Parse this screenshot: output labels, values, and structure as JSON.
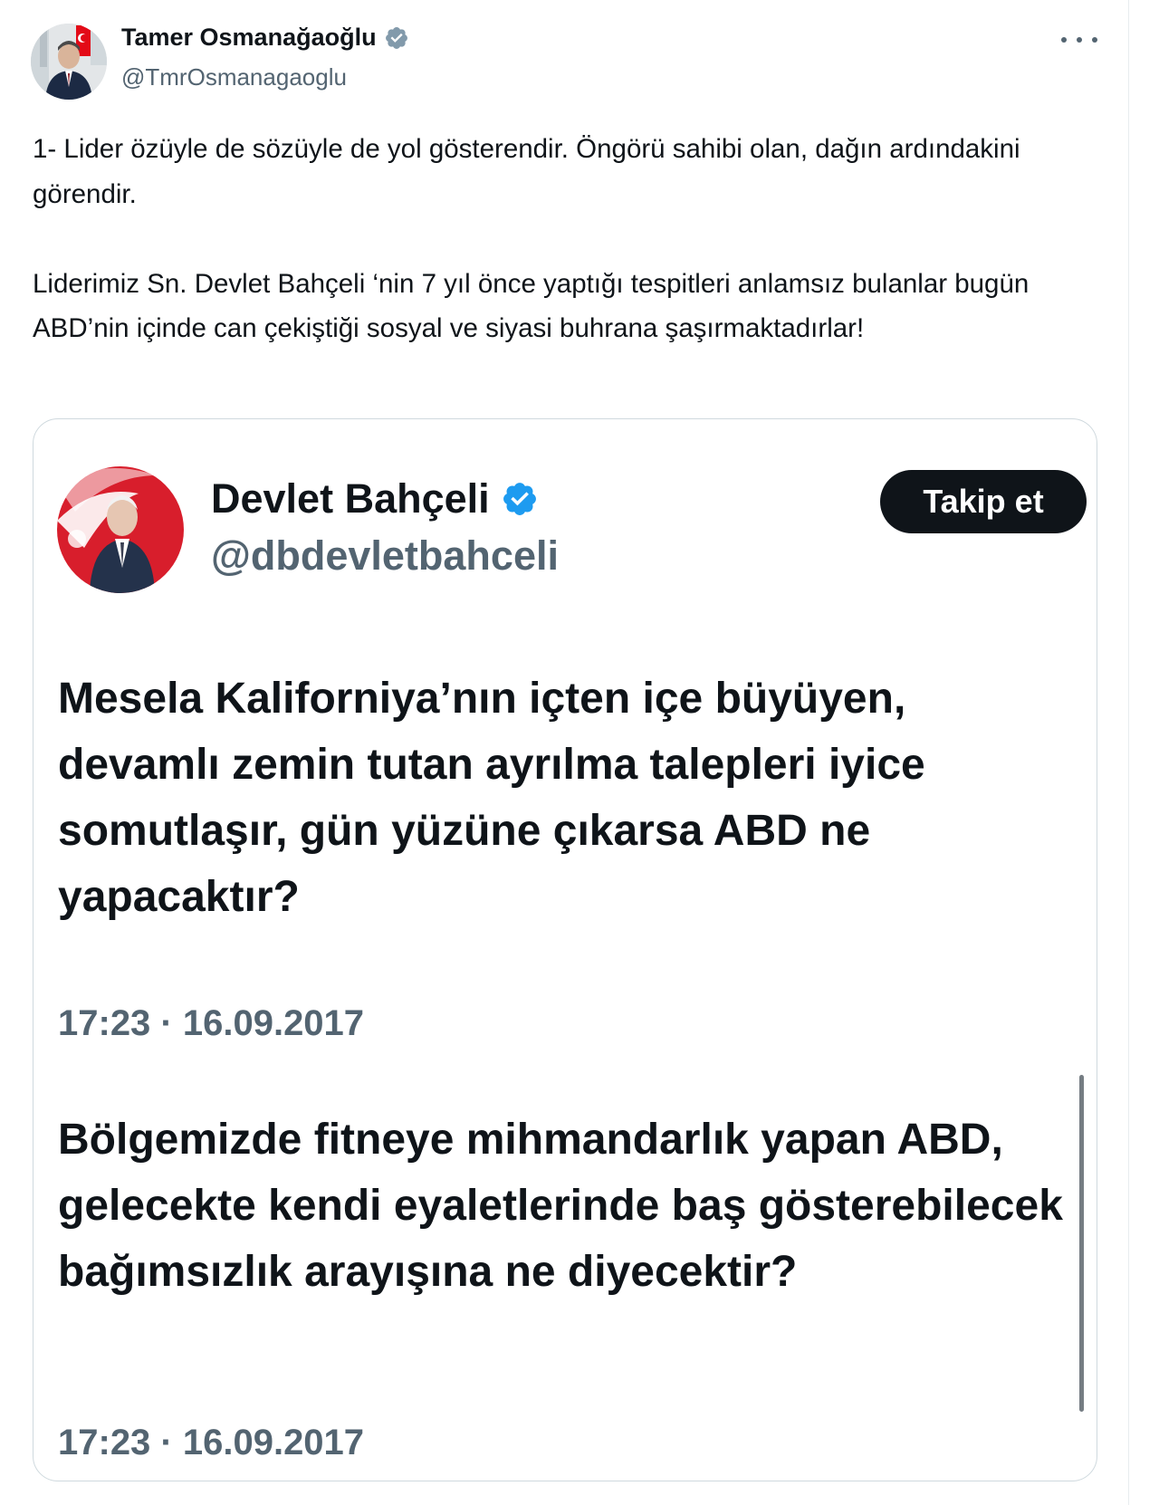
{
  "author": {
    "name": "Tamer Osmanağaoğlu",
    "handle": "@TmrOsmanagaoglu",
    "verified": true
  },
  "menu": {
    "icon": "more-horizontal-icon"
  },
  "tweet": {
    "paragraphs": [
      "1- Lider özüyle de sözüyle de yol gösterendir. Öngörü sahibi olan, dağın ardındakini görendir.",
      "Liderimiz Sn. Devlet Bahçeli ‘nin 7 yıl önce yaptığı tespitleri anlamsız bulanlar bugün ABD’nin içinde can çekiştiği sosyal ve siyasi buhrana şaşırmaktadırlar!"
    ]
  },
  "quote": {
    "name": "Devlet Bahçeli",
    "handle": "@dbdevletbahceli",
    "verified": true,
    "follow_label": "Takip et",
    "posts": [
      {
        "text": "Mesela Kaliforniya’nın içten içe büyüyen, devamlı zemin tutan ayrılma talepleri iyice somutlaşır, gün yüzüne çıkarsa ABD ne yapacaktır?",
        "timestamp": "17:23 · 16.09.2017"
      },
      {
        "text": "Bölgemizde fitneye mihmandarlık yapan ABD, gelecekte kendi eyaletlerinde baş gösterebilecek bağımsızlık arayışına ne diyecektir?",
        "timestamp": "17:23 · 16.09.2017"
      }
    ]
  },
  "colors": {
    "text_primary": "#0f1419",
    "text_secondary": "#536471",
    "verified_blue": "#1d9bf0",
    "border": "#cfd9de",
    "button_bg": "#0f1419"
  }
}
